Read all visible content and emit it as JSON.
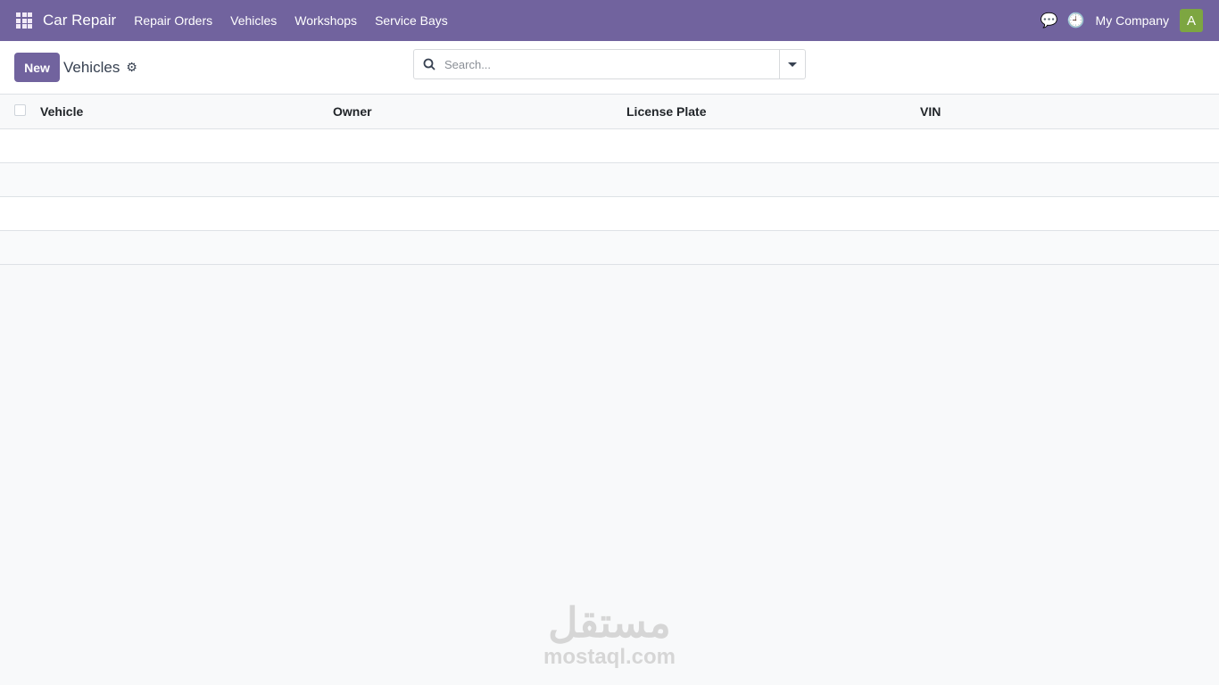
{
  "navbar": {
    "app_name": "Car Repair",
    "menu": [
      "Repair Orders",
      "Vehicles",
      "Workshops",
      "Service Bays"
    ],
    "company": "My Company",
    "avatar_initial": "A"
  },
  "control": {
    "new_label": "New",
    "title": "Vehicles",
    "search_placeholder": "Search..."
  },
  "table": {
    "columns": [
      "Vehicle",
      "Owner",
      "License Plate",
      "VIN"
    ],
    "rows": []
  },
  "watermark": {
    "arabic": "مستقل",
    "latin": "mostaql.com"
  },
  "colors": {
    "brand": "#71639e",
    "avatar": "#7da641"
  }
}
